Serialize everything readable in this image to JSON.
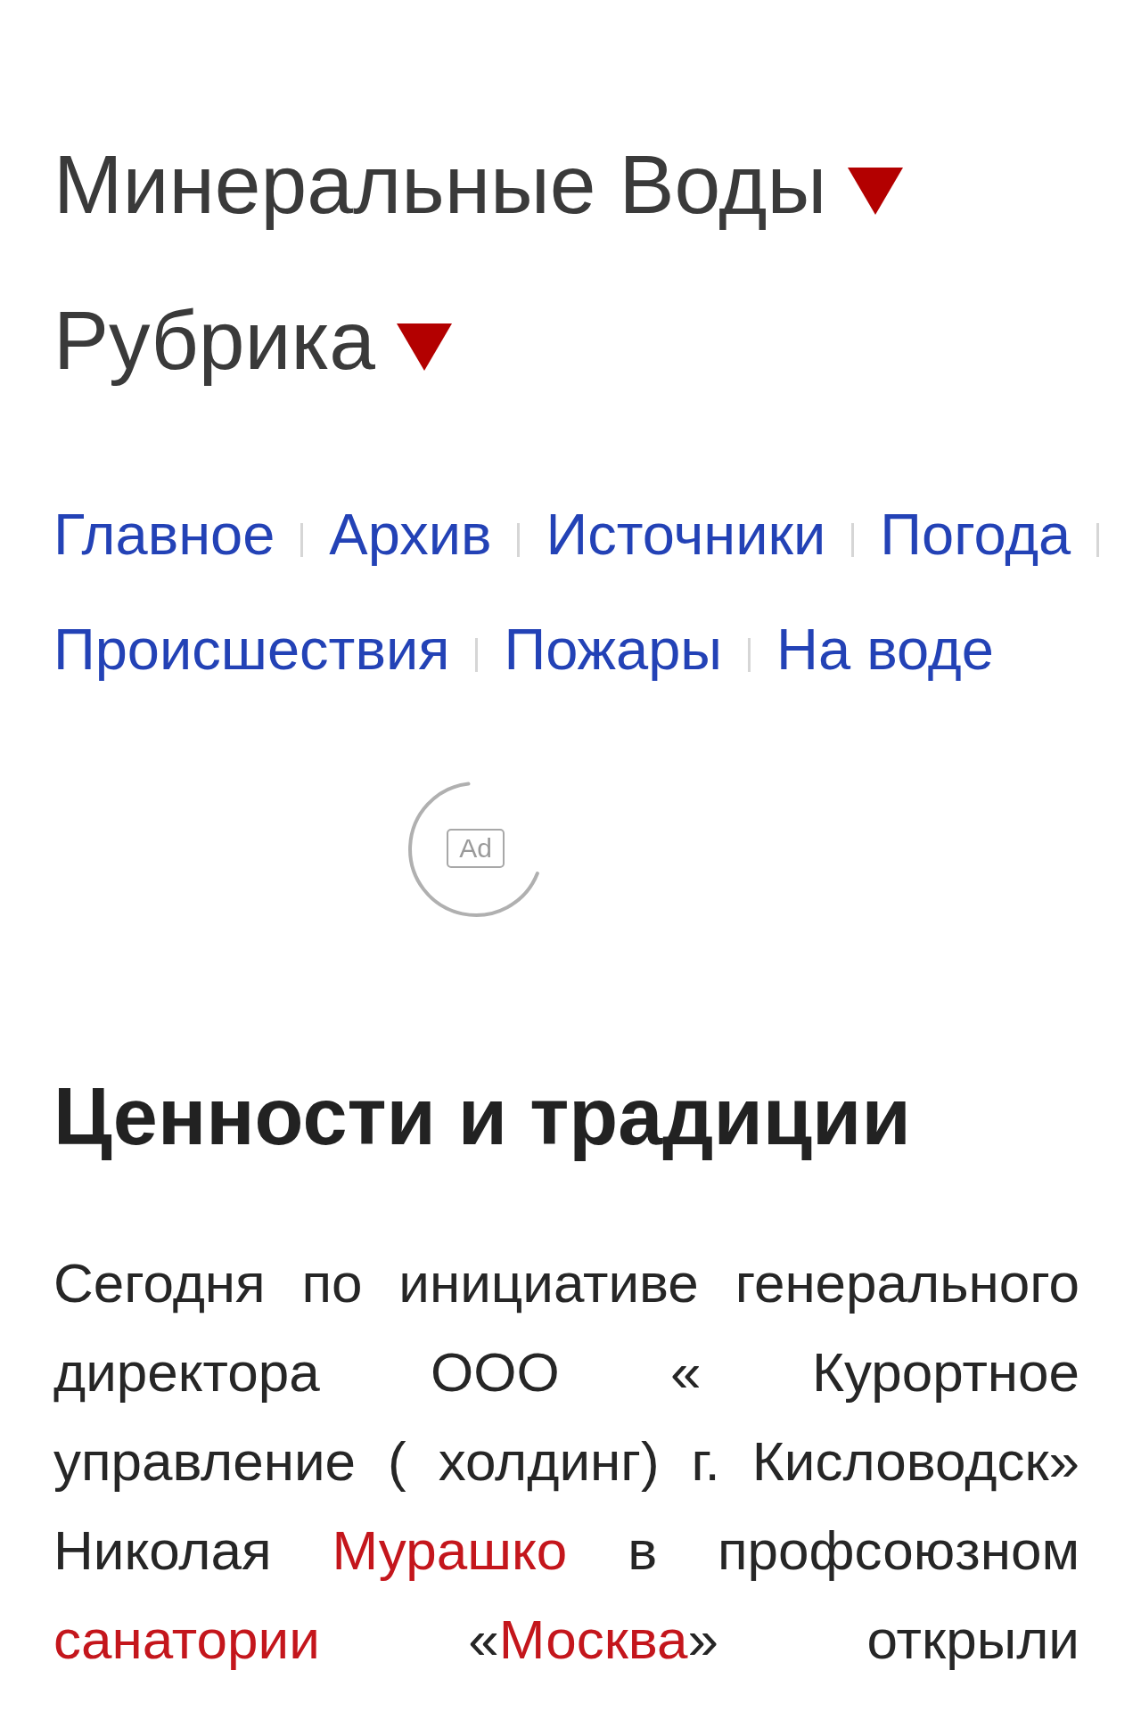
{
  "dropdowns": [
    {
      "label": "Минеральные Воды"
    },
    {
      "label": "Рубрика"
    }
  ],
  "nav": {
    "links": [
      "Главное",
      "Архив",
      "Источники",
      "Погода",
      "Происшествия",
      "Пожары",
      "На воде"
    ]
  },
  "ad": {
    "label": "Ad"
  },
  "article": {
    "title": "Ценности и традиции",
    "paragraph": [
      {
        "kind": "text",
        "text": "Сегодня по инициативе генерального директора ООО « Курортное управление ( холдинг) г. Кисловодск» Николая "
      },
      {
        "kind": "link",
        "text": "Мурашко"
      },
      {
        "kind": "text",
        "text": " в профсоюзном "
      },
      {
        "kind": "link",
        "text": "санатории"
      },
      {
        "kind": "text",
        "text": " «"
      },
      {
        "kind": "link",
        "text": "Москва"
      },
      {
        "kind": "text",
        "text": "» открыли"
      }
    ]
  }
}
